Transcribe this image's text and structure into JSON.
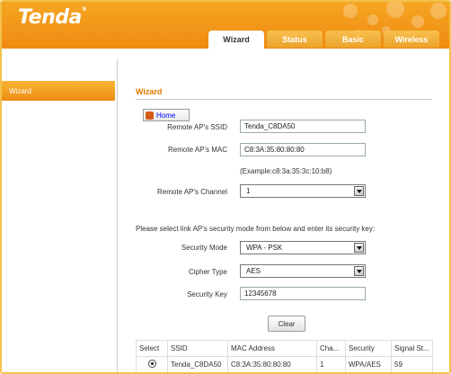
{
  "brand": {
    "logo": "Tenda",
    "mark": "®"
  },
  "tabs": [
    {
      "label": "Wizard",
      "active": true
    },
    {
      "label": "Status",
      "active": false
    },
    {
      "label": "Basic",
      "active": false
    },
    {
      "label": "Wireless",
      "active": false
    }
  ],
  "sidebar": {
    "items": [
      {
        "label": "Wizard"
      }
    ]
  },
  "main": {
    "title": "Wizard",
    "home_label": "Home",
    "remote_ssid": {
      "label": "Remote AP's SSID",
      "value": "Tenda_C8DA50"
    },
    "remote_mac": {
      "label": "Remote AP's MAC",
      "value": "C8:3A:35:80:80:80",
      "example": "(Example:c8:3a:35:3c:10:b8)"
    },
    "remote_channel": {
      "label": "Remote AP's Channel",
      "value": "1"
    },
    "instruction": "Please select link AP's security mode from below and enter its security key:",
    "security_mode": {
      "label": "Security Mode",
      "value": "WPA - PSK"
    },
    "cipher_type": {
      "label": "Cipher Type",
      "value": "AES"
    },
    "security_key": {
      "label": "Security Key",
      "value": "12345678"
    },
    "clear_label": "Clear"
  },
  "table": {
    "headers": [
      "Select",
      "SSID",
      "MAC Address",
      "Cha...",
      "Security",
      "Signal St..."
    ],
    "rows": [
      {
        "ssid": "Tenda_C8DA50",
        "mac": "C8:3A:35:80:80:80",
        "channel": "1",
        "security": "WPA/AES",
        "signal": "59"
      }
    ]
  },
  "colors": {
    "accent": "#f08a10",
    "title": "#e07b00",
    "frame": "#f3c14b"
  }
}
